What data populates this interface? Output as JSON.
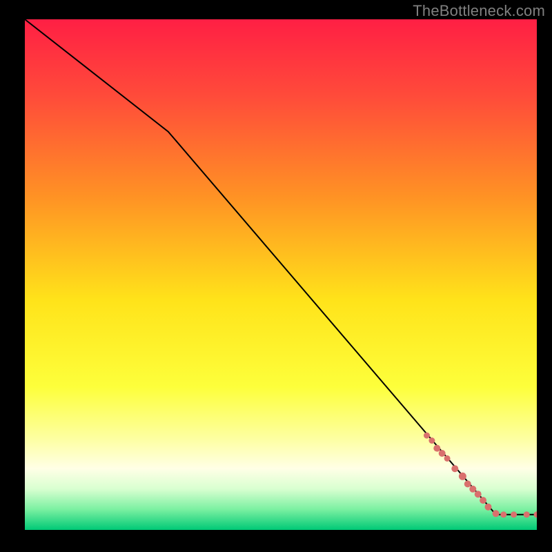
{
  "watermark": "TheBottleneck.com",
  "chart_data": {
    "type": "line",
    "title": "",
    "xlabel": "",
    "ylabel": "",
    "xlim": [
      0,
      100
    ],
    "ylim": [
      0,
      100
    ],
    "curve": [
      {
        "x": 0,
        "y": 100
      },
      {
        "x": 28,
        "y": 78
      },
      {
        "x": 92,
        "y": 3
      },
      {
        "x": 100,
        "y": 3
      }
    ],
    "dots": [
      {
        "x": 78.5,
        "y": 18.5,
        "r": 4.5
      },
      {
        "x": 79.5,
        "y": 17.5,
        "r": 4.5
      },
      {
        "x": 80.5,
        "y": 16.0,
        "r": 5.0
      },
      {
        "x": 81.5,
        "y": 15.0,
        "r": 5.0
      },
      {
        "x": 82.5,
        "y": 14.0,
        "r": 4.5
      },
      {
        "x": 84.0,
        "y": 12.0,
        "r": 5.0
      },
      {
        "x": 85.5,
        "y": 10.5,
        "r": 5.5
      },
      {
        "x": 86.5,
        "y": 9.0,
        "r": 5.0
      },
      {
        "x": 87.5,
        "y": 8.0,
        "r": 5.0
      },
      {
        "x": 88.5,
        "y": 7.0,
        "r": 5.0
      },
      {
        "x": 89.5,
        "y": 5.8,
        "r": 5.0
      },
      {
        "x": 90.5,
        "y": 4.5,
        "r": 5.0
      },
      {
        "x": 92.0,
        "y": 3.2,
        "r": 5.0
      },
      {
        "x": 93.5,
        "y": 3.0,
        "r": 4.5
      },
      {
        "x": 95.5,
        "y": 3.0,
        "r": 4.5
      },
      {
        "x": 98.0,
        "y": 3.0,
        "r": 4.5
      },
      {
        "x": 100.0,
        "y": 3.0,
        "r": 4.5
      }
    ],
    "colors": {
      "dot": "#d9706d",
      "line": "#000000",
      "gradient_stops": [
        {
          "offset": 0.0,
          "color": "#ff1f44"
        },
        {
          "offset": 0.15,
          "color": "#ff4b3a"
        },
        {
          "offset": 0.35,
          "color": "#ff9324"
        },
        {
          "offset": 0.55,
          "color": "#ffe31a"
        },
        {
          "offset": 0.72,
          "color": "#fdff3b"
        },
        {
          "offset": 0.82,
          "color": "#fdffa0"
        },
        {
          "offset": 0.88,
          "color": "#ffffe6"
        },
        {
          "offset": 0.92,
          "color": "#d8ffd0"
        },
        {
          "offset": 0.96,
          "color": "#7af0a1"
        },
        {
          "offset": 1.0,
          "color": "#00c976"
        }
      ]
    }
  }
}
